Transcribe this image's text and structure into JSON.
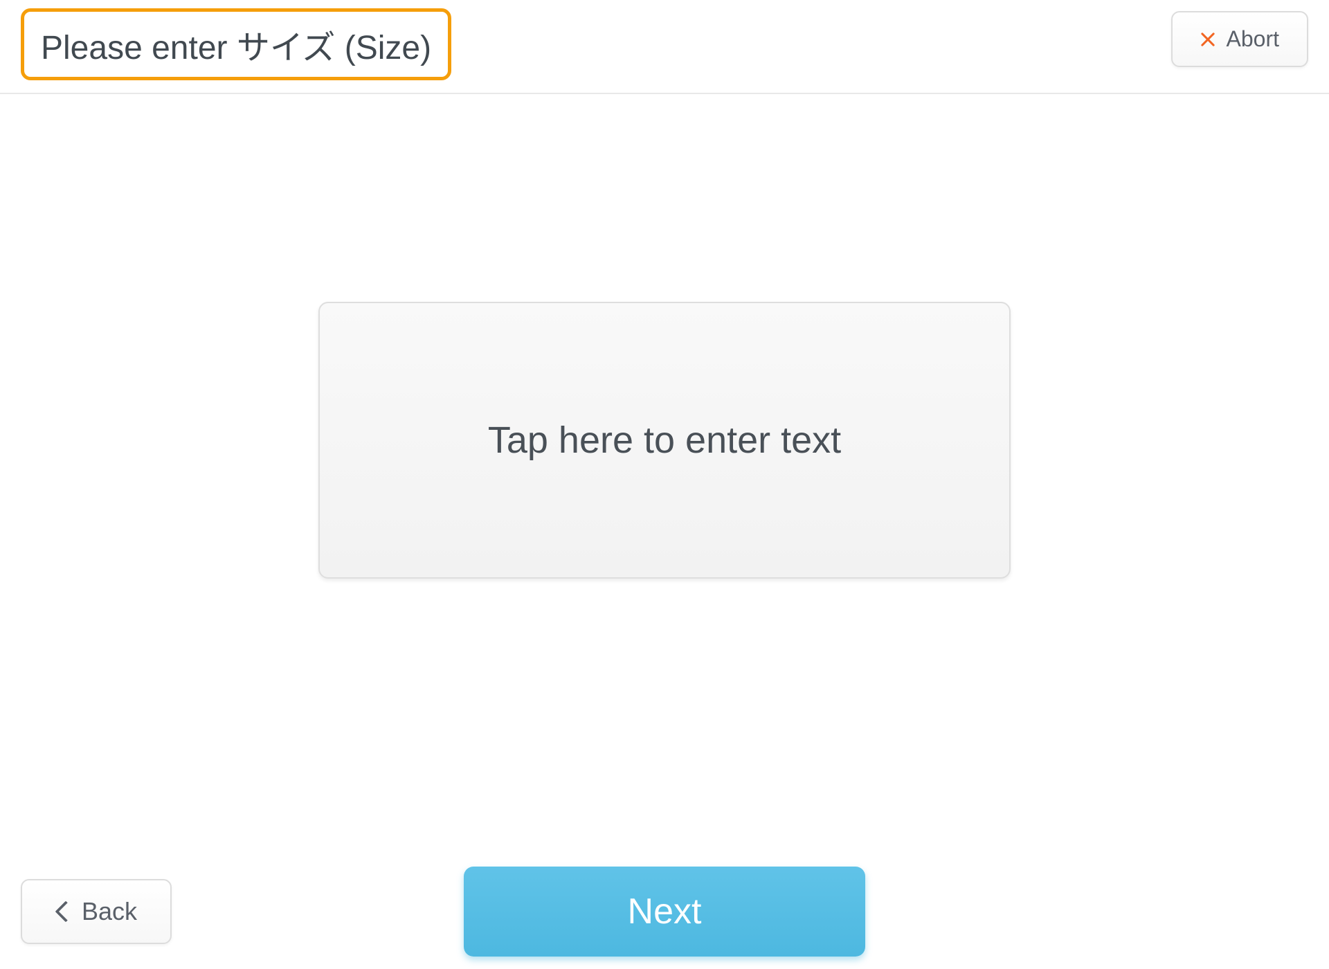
{
  "header": {
    "title": "Please enter サイズ (Size)",
    "abort_label": "Abort"
  },
  "main": {
    "input_placeholder": "Tap here to enter text"
  },
  "footer": {
    "back_label": "Back",
    "next_label": "Next"
  }
}
